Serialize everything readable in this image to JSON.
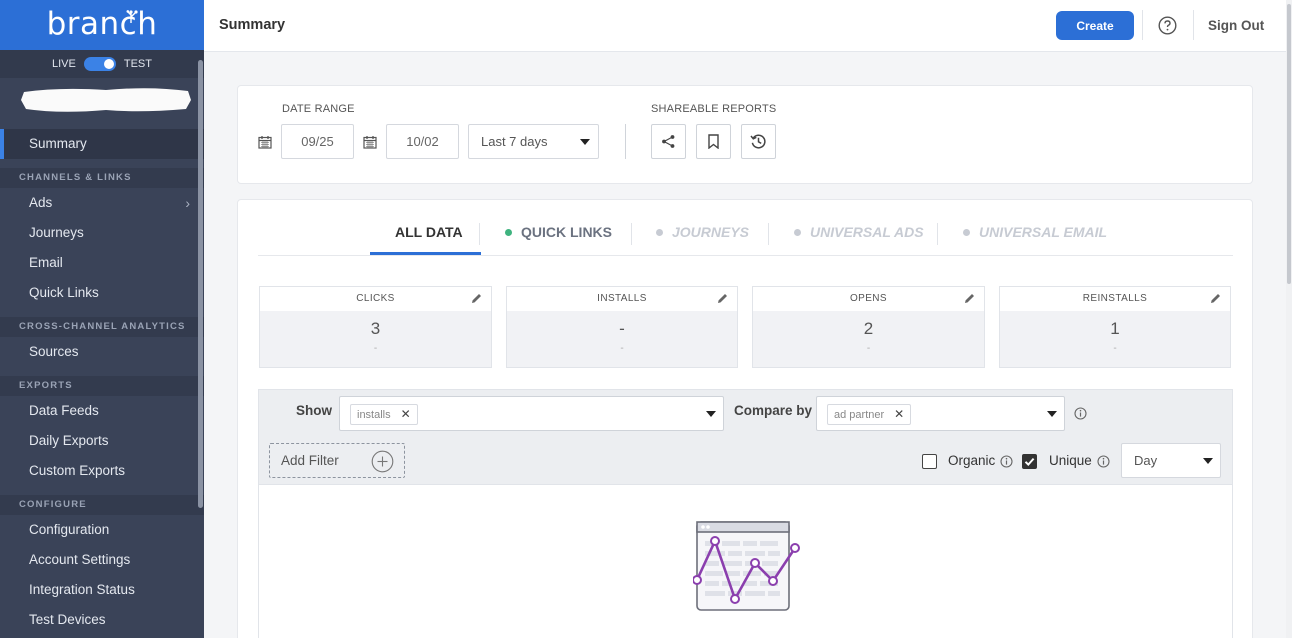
{
  "sidebar": {
    "logo": "branch",
    "env": {
      "live": "LIVE",
      "test": "TEST",
      "mode": "test"
    },
    "items": {
      "summary": "Summary",
      "section_channels": "CHANNELS & LINKS",
      "ads": "Ads",
      "journeys": "Journeys",
      "email": "Email",
      "quick_links": "Quick Links",
      "section_analytics": "CROSS-CHANNEL ANALYTICS",
      "sources": "Sources",
      "section_exports": "EXPORTS",
      "data_feeds": "Data Feeds",
      "daily_exports": "Daily Exports",
      "custom_exports": "Custom Exports",
      "section_configure": "CONFIGURE",
      "configuration": "Configuration",
      "account_settings": "Account Settings",
      "integration_status": "Integration Status",
      "test_devices": "Test Devices"
    }
  },
  "header": {
    "title": "Summary",
    "create": "Create",
    "sign_out": "Sign Out"
  },
  "filters": {
    "date_range_label": "DATE RANGE",
    "start_date": "09/25",
    "end_date": "10/02",
    "preset": "Last 7 days",
    "shareable_label": "SHAREABLE REPORTS"
  },
  "tabs": {
    "all_data": "ALL DATA",
    "quick_links": "QUICK LINKS",
    "journeys": "JOURNEYS",
    "universal_ads": "UNIVERSAL ADS",
    "universal_email": "UNIVERSAL EMAIL"
  },
  "stats": {
    "clicks": {
      "label": "CLICKS",
      "value": "3",
      "sub": "-"
    },
    "installs": {
      "label": "INSTALLS",
      "value": "-",
      "sub": "-"
    },
    "opens": {
      "label": "OPENS",
      "value": "2",
      "sub": "-"
    },
    "reinstalls": {
      "label": "REINSTALLS",
      "value": "1",
      "sub": "-"
    }
  },
  "query": {
    "show_label": "Show",
    "show_chip": "installs",
    "compare_label": "Compare by",
    "compare_chip": "ad partner",
    "add_filter": "Add Filter",
    "organic_label": "Organic",
    "organic_checked": false,
    "unique_label": "Unique",
    "unique_checked": true,
    "granularity": "Day"
  },
  "colors": {
    "brand_blue": "#2c6fd6",
    "sidebar_bg": "#3a4358",
    "quick_links_dot": "#3fb37f",
    "illustration_purple": "#8b3fae"
  }
}
